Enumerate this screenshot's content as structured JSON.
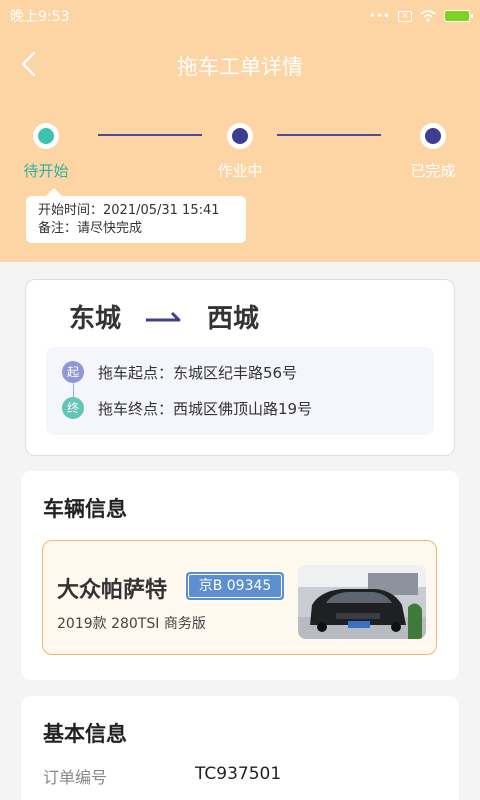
{
  "statusbar": {
    "time": "晚上9:53",
    "dots": "•••",
    "sim": "×"
  },
  "nav": {
    "title": "拖车工单详情"
  },
  "steps": [
    {
      "label": "待开始",
      "state": "active"
    },
    {
      "label": "作业中",
      "state": "pending"
    },
    {
      "label": "已完成",
      "state": "pending"
    }
  ],
  "tooltip": {
    "start_time": "开始时间：2021/05/31 15:41",
    "remark": "备注：请尽快完成"
  },
  "route": {
    "from_city": "东城",
    "to_city": "西城",
    "start_badge": "起",
    "end_badge": "终",
    "start_address": "拖车起点：东城区纪丰路56号",
    "end_address": "拖车终点：西城区佛顶山路19号"
  },
  "vehicle": {
    "section_title": "车辆信息",
    "name": "大众帕萨特",
    "plate": "京B 09345",
    "model": "2019款 280TSI 商务版"
  },
  "basic": {
    "section_title": "基本信息",
    "order_label": "订单编号",
    "order_value": "TC937501"
  },
  "colors": {
    "header_bg": "#fdd5a4",
    "active_step": "#3cc3b0",
    "pending_step": "#3e3f94",
    "vehicle_border": "#f4b66d",
    "plate_bg": "#5b8fd0"
  }
}
